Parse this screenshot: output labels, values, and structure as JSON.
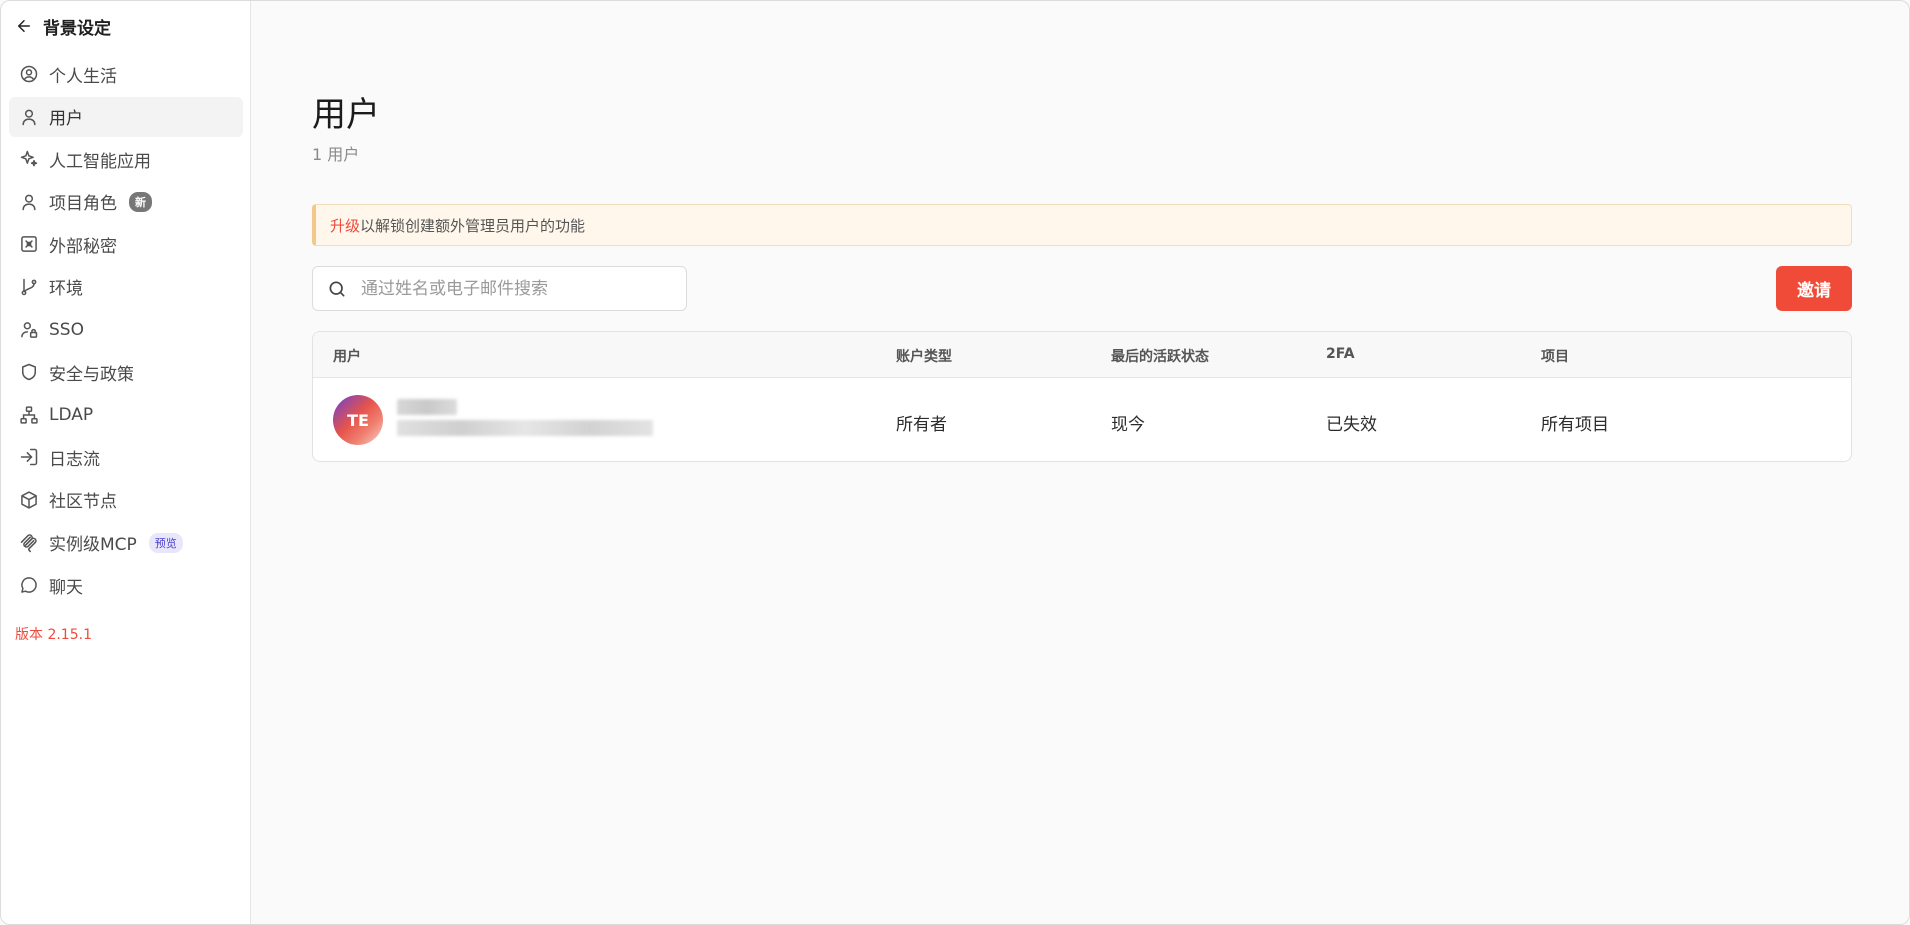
{
  "sidebar": {
    "back_title": "背景设定",
    "items": [
      {
        "label": "个人生活",
        "icon": "user-circle-icon"
      },
      {
        "label": "用户",
        "icon": "user-icon",
        "active": true
      },
      {
        "label": "人工智能应用",
        "icon": "sparkles-icon"
      },
      {
        "label": "项目角色",
        "icon": "user-icon",
        "badge": "新"
      },
      {
        "label": "外部秘密",
        "icon": "vault-icon"
      },
      {
        "label": "环境",
        "icon": "git-branch-icon"
      },
      {
        "label": "SSO",
        "icon": "user-lock-icon"
      },
      {
        "label": "安全与政策",
        "icon": "shield-icon"
      },
      {
        "label": "LDAP",
        "icon": "network-icon"
      },
      {
        "label": "日志流",
        "icon": "log-in-icon"
      },
      {
        "label": "社区节点",
        "icon": "box-icon"
      },
      {
        "label": "实例级MCP",
        "icon": "mcp-icon",
        "badge": "预览"
      },
      {
        "label": "聊天",
        "icon": "chat-icon"
      }
    ],
    "version": "版本 2.15.1"
  },
  "main": {
    "title": "用户",
    "subtitle": "1 用户",
    "banner": {
      "link": "升级",
      "text": "以解锁创建额外管理员用户的功能"
    },
    "search": {
      "placeholder": "通过姓名或电子邮件搜索"
    },
    "invite_label": "邀请",
    "table": {
      "headers": [
        "用户",
        "账户类型",
        "最后的活跃状态",
        "2FA",
        "项目"
      ],
      "rows": [
        {
          "avatar_initials": "TE",
          "account_type": "所有者",
          "last_active": "现今",
          "twofa": "已失效",
          "projects": "所有项目"
        }
      ]
    }
  },
  "colors": {
    "accent": "#f04b38",
    "version": "#ef4b3c",
    "banner_bg": "#fff7ec"
  }
}
